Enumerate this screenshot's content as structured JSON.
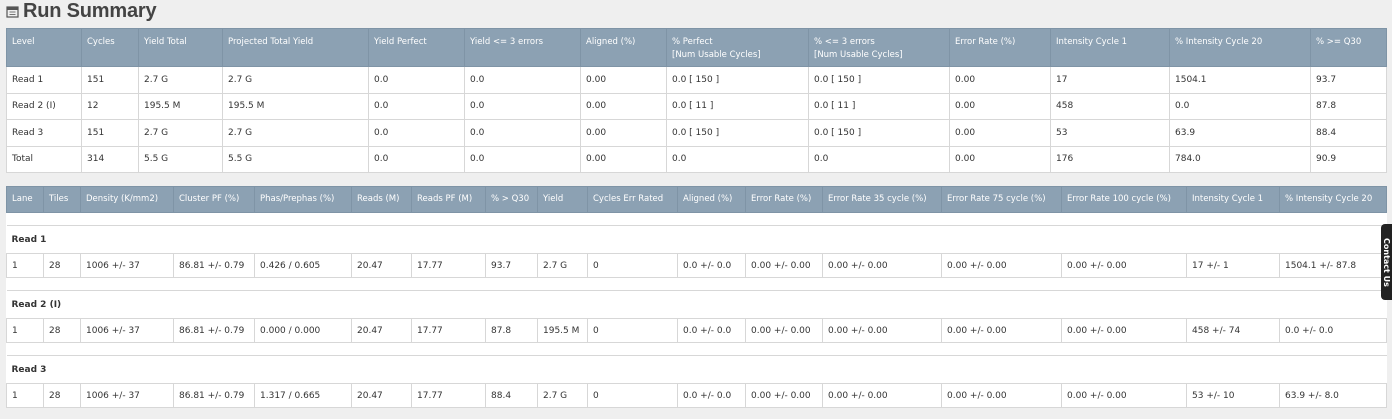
{
  "page": {
    "title": "Run Summary",
    "icon": "calendar-icon"
  },
  "summary": {
    "headers": [
      "Level",
      "Cycles",
      "Yield Total",
      "Projected Total Yield",
      "Yield Perfect",
      "Yield <= 3 errors",
      "Aligned (%)",
      "% Perfect\n[Num Usable Cycles]",
      "% <= 3 errors\n[Num Usable Cycles]",
      "Error Rate (%)",
      "Intensity Cycle 1",
      "% Intensity Cycle 20",
      "% >= Q30"
    ],
    "rows": [
      [
        "Read 1",
        "151",
        "2.7 G",
        "2.7 G",
        "0.0",
        "0.0",
        "0.00",
        "0.0 [ 150 ]",
        "0.0 [ 150 ]",
        "0.00",
        "17",
        "1504.1",
        "93.7"
      ],
      [
        "Read 2 (I)",
        "12",
        "195.5 M",
        "195.5 M",
        "0.0",
        "0.0",
        "0.00",
        "0.0 [ 11 ]",
        "0.0 [ 11 ]",
        "0.00",
        "458",
        "0.0",
        "87.8"
      ],
      [
        "Read 3",
        "151",
        "2.7 G",
        "2.7 G",
        "0.0",
        "0.0",
        "0.00",
        "0.0 [ 150 ]",
        "0.0 [ 150 ]",
        "0.00",
        "53",
        "63.9",
        "88.4"
      ],
      [
        "Total",
        "314",
        "5.5 G",
        "5.5 G",
        "0.0",
        "0.0",
        "0.00",
        "0.0",
        "0.0",
        "0.00",
        "176",
        "784.0",
        "90.9"
      ]
    ]
  },
  "lanes": {
    "headers": [
      "Lane",
      "Tiles",
      "Density (K/mm2)",
      "Cluster PF (%)",
      "Phas/Prephas (%)",
      "Reads (M)",
      "Reads PF (M)",
      "% > Q30",
      "Yield",
      "Cycles Err Rated",
      "Aligned (%)",
      "Error Rate (%)",
      "Error Rate 35 cycle (%)",
      "Error Rate 75 cycle (%)",
      "Error Rate 100 cycle (%)",
      "Intensity Cycle 1",
      "% Intensity Cycle 20"
    ],
    "groups": [
      {
        "name": "Read 1",
        "rows": [
          [
            "1",
            "28",
            "1006 +/- 37",
            "86.81 +/- 0.79",
            "0.426 / 0.605",
            "20.47",
            "17.77",
            "93.7",
            "2.7 G",
            "0",
            "0.0 +/- 0.0",
            "0.00 +/- 0.00",
            "0.00 +/- 0.00",
            "0.00 +/- 0.00",
            "0.00 +/- 0.00",
            "17 +/- 1",
            "1504.1 +/- 87.8"
          ]
        ]
      },
      {
        "name": "Read 2 (I)",
        "rows": [
          [
            "1",
            "28",
            "1006 +/- 37",
            "86.81 +/- 0.79",
            "0.000 / 0.000",
            "20.47",
            "17.77",
            "87.8",
            "195.5 M",
            "0",
            "0.0 +/- 0.0",
            "0.00 +/- 0.00",
            "0.00 +/- 0.00",
            "0.00 +/- 0.00",
            "0.00 +/- 0.00",
            "458 +/- 74",
            "0.0 +/- 0.0"
          ]
        ]
      },
      {
        "name": "Read 3",
        "rows": [
          [
            "1",
            "28",
            "1006 +/- 37",
            "86.81 +/- 0.79",
            "1.317 / 0.665",
            "20.47",
            "17.77",
            "88.4",
            "2.7 G",
            "0",
            "0.0 +/- 0.0",
            "0.00 +/- 0.00",
            "0.00 +/- 0.00",
            "0.00 +/- 0.00",
            "0.00 +/- 0.00",
            "53 +/- 10",
            "63.9 +/- 8.0"
          ]
        ]
      }
    ]
  },
  "side_tab": {
    "label": "Contact Us"
  }
}
